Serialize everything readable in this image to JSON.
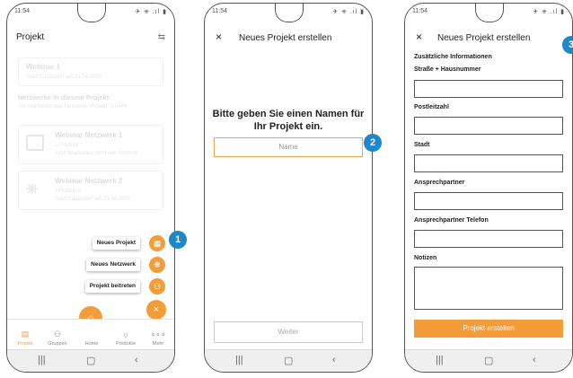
{
  "statusbar": {
    "time": "11:54",
    "icons": "✈ ⎈ .ıl ▮"
  },
  "screen1": {
    "title": "Projekt",
    "header_icon": "⇆",
    "project_card": {
      "title": "Webinar 1",
      "subtitle": "zuletzt geändert am 21.04.2023"
    },
    "networks_heading": "Netzwerke in diesem Projekt",
    "networks_hint": "Sie bearbeiten das Netzwerk \"Projekt\" 1 0445",
    "network_cards": [
      {
        "title": "Webinar Netzwerk 1",
        "line1": "1 Produkt",
        "line2": "noch bearbeiten von Leon Schmidt"
      },
      {
        "title": "Webinar Netzwerk 2",
        "line1": "0 Produkte",
        "line2": "zuletzt geändert am 21.04.2023"
      }
    ],
    "fab_actions": [
      {
        "label": "Neues Projekt",
        "icon": "▦"
      },
      {
        "label": "Neues Netzwerk",
        "icon": "❋"
      },
      {
        "label": "Projekt beitreten",
        "icon": "⚇"
      }
    ],
    "fab_close": "×",
    "tabs": [
      {
        "label": "Projekt",
        "icon": "▤"
      },
      {
        "label": "Gruppen",
        "icon": "⚇"
      },
      {
        "label": "Home",
        "icon": "⌂"
      },
      {
        "label": "Produkte",
        "icon": "○"
      },
      {
        "label": "Mehr",
        "icon": "∘∘∘"
      }
    ],
    "badge": "1"
  },
  "screen2": {
    "close": "×",
    "title": "Neues Projekt erstellen",
    "prompt": "Bitte geben Sie einen Namen für Ihr Projekt ein.",
    "name_placeholder": "Name",
    "next_button": "Weiter",
    "badge": "2"
  },
  "screen3": {
    "close": "×",
    "title": "Neues Projekt erstellen",
    "section": "Zusätzliche Informationen",
    "fields": [
      "Straße + Hausnummer",
      "Postleitzahl",
      "Stadt",
      "Ansprechpartner",
      "Ansprechpartner Telefon",
      "Notizen"
    ],
    "submit": "Projekt erstellen",
    "badge": "3"
  },
  "sysnav": {
    "recent": "|||",
    "home": "▢",
    "back": "‹"
  },
  "colors": {
    "accent": "#f39c3a",
    "badge": "#1f86c8"
  }
}
